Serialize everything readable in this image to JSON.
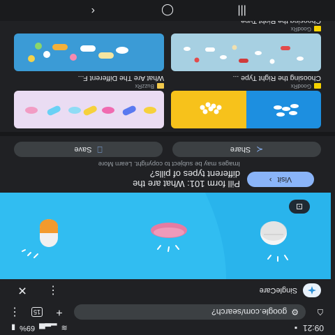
{
  "status_bar": {
    "time": "09:21",
    "battery": "69%"
  },
  "browser": {
    "url": "google.com/search?",
    "tab_count": "15",
    "new_tab_icon": "plus-icon",
    "menu_icon": "more-vert-icon",
    "home_icon": "home-icon"
  },
  "source": {
    "name": "SingleCare",
    "logo_icon": "singlecare-logo"
  },
  "result": {
    "title_line1": "Pill form 101: What are the",
    "title_line2": "different types of pills?",
    "copyright": "Images may be subject to copyright. Learn More",
    "visit_label": "Visit",
    "share_label": "Share",
    "save_label": "Save"
  },
  "related": [
    {
      "source": "GoodRx",
      "title": "Choosing the Right Type ...",
      "fav_color": "#f5d200"
    },
    {
      "source": "BuzzRx",
      "title": "What Are The Different F...",
      "fav_color": "#f2c94c"
    },
    {
      "source": "GoodRx",
      "title": "Choosing the Right Type ...",
      "fav_color": "#f5d200"
    },
    {
      "source": "",
      "title": "",
      "fav_color": ""
    }
  ],
  "colors": {
    "accent": "#8ab4f8",
    "background": "#202124",
    "hero_blue": "#2bb6ee"
  }
}
